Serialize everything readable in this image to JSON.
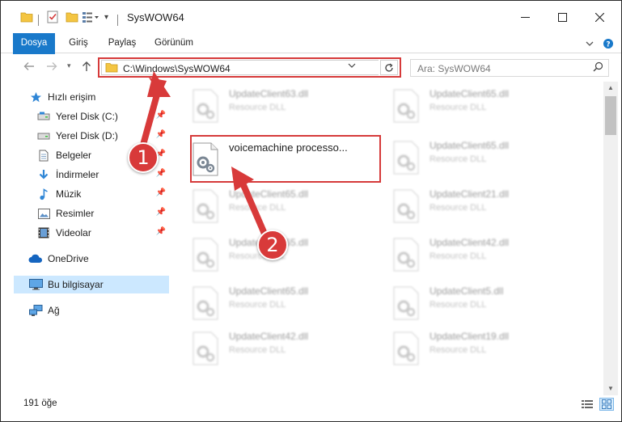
{
  "window": {
    "title": "SysWOW64"
  },
  "ribbon": {
    "tabs": [
      "Dosya",
      "Giriş",
      "Paylaş",
      "Görünüm"
    ],
    "help_icon": "help-icon",
    "expand_icon": "chevron-down-icon"
  },
  "address": {
    "path": "C:\\Windows\\SysWOW64"
  },
  "search": {
    "placeholder": "Ara: SysWOW64"
  },
  "nav": {
    "items": [
      {
        "label": "Hızlı erişim",
        "icon": "star-icon",
        "pinned": false
      },
      {
        "label": "Yerel Disk (C:)",
        "icon": "drive-icon",
        "pinned": true
      },
      {
        "label": "Yerel Disk (D:)",
        "icon": "drive-icon",
        "pinned": true
      },
      {
        "label": "Belgeler",
        "icon": "document-icon",
        "pinned": true
      },
      {
        "label": "İndirmeler",
        "icon": "download-icon",
        "pinned": true
      },
      {
        "label": "Müzik",
        "icon": "music-icon",
        "pinned": true
      },
      {
        "label": "Resimler",
        "icon": "pictures-icon",
        "pinned": true
      },
      {
        "label": "Videolar",
        "icon": "video-icon",
        "pinned": true
      },
      {
        "label": "OneDrive",
        "icon": "cloud-icon",
        "pinned": false
      },
      {
        "label": "Bu bilgisayar",
        "icon": "computer-icon",
        "pinned": false,
        "selected": true
      },
      {
        "label": "Ağ",
        "icon": "network-icon",
        "pinned": false
      }
    ]
  },
  "files": {
    "left": [
      {
        "name": "UpdateClient63.dll",
        "type": "Resource DLL"
      },
      {
        "name": "voicemachine processo...",
        "type": ""
      },
      {
        "name": "UpdateClient65.dll",
        "type": "Resource DLL"
      },
      {
        "name": "UpdateClient65.dll",
        "type": "Resource DLL"
      },
      {
        "name": "UpdateClient65.dll",
        "type": "Resource DLL"
      },
      {
        "name": "UpdateClient42.dll",
        "type": "Resource DLL"
      }
    ],
    "right": [
      {
        "name": "UpdateClient65.dll",
        "type": "Resource DLL"
      },
      {
        "name": "UpdateClient65.dll",
        "type": "Resource DLL"
      },
      {
        "name": "UpdateClient21.dll",
        "type": "Resource DLL"
      },
      {
        "name": "UpdateClient42.dll",
        "type": "Resource DLL"
      },
      {
        "name": "UpdateClient5.dll",
        "type": "Resource DLL"
      },
      {
        "name": "UpdateClient19.dll",
        "type": "Resource DLL"
      }
    ]
  },
  "status": {
    "count": "191 öğe"
  },
  "callouts": {
    "one": "1",
    "two": "2"
  },
  "colors": {
    "accent": "#1979ca",
    "highlight": "#d63a3a",
    "selected": "#cce8ff"
  }
}
